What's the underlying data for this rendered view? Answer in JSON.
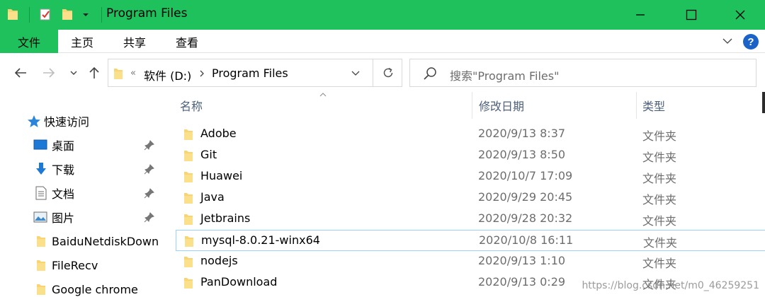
{
  "window": {
    "title": "Program Files",
    "controls": {
      "minimize": "minimize-icon",
      "maximize": "maximize-icon",
      "close": "close-icon"
    }
  },
  "ribbon": {
    "tabs": [
      {
        "label": "文件",
        "active": true
      },
      {
        "label": "主页"
      },
      {
        "label": "共享"
      },
      {
        "label": "查看"
      }
    ],
    "accent_color": "#1ec15b"
  },
  "address": {
    "overflow": "«",
    "segments": [
      "软件 (D:)",
      "Program Files"
    ],
    "search_placeholder": "搜索\"Program Files\""
  },
  "navpane": {
    "quick_access": "快速访问",
    "items": [
      {
        "label": "桌面",
        "icon": "desktop-icon",
        "pinned": true
      },
      {
        "label": "下载",
        "icon": "download-icon",
        "pinned": true
      },
      {
        "label": "文档",
        "icon": "document-icon",
        "pinned": true
      },
      {
        "label": "图片",
        "icon": "pictures-icon",
        "pinned": true
      },
      {
        "label": "BaiduNetdiskDown",
        "icon": "folder-icon",
        "pinned": false
      },
      {
        "label": "FileRecv",
        "icon": "folder-icon",
        "pinned": false
      },
      {
        "label": "Google chrome",
        "icon": "folder-icon",
        "pinned": false
      }
    ]
  },
  "filelist": {
    "columns": {
      "name": "名称",
      "date": "修改日期",
      "type": "类型"
    },
    "rows": [
      {
        "name": "Adobe",
        "date": "2020/9/13 8:37",
        "type": "文件夹"
      },
      {
        "name": "Git",
        "date": "2020/9/13 8:50",
        "type": "文件夹"
      },
      {
        "name": "Huawei",
        "date": "2020/10/7 17:09",
        "type": "文件夹"
      },
      {
        "name": "Java",
        "date": "2020/9/29 20:45",
        "type": "文件夹"
      },
      {
        "name": "Jetbrains",
        "date": "2020/9/28 20:32",
        "type": "文件夹"
      },
      {
        "name": "mysql-8.0.21-winx64",
        "date": "2020/10/8 16:11",
        "type": "文件夹",
        "hovered": true
      },
      {
        "name": "nodejs",
        "date": "2020/9/13 1:10",
        "type": "文件夹"
      },
      {
        "name": "PanDownload",
        "date": "2020/9/13 0:29",
        "type": "文件夹"
      }
    ]
  },
  "watermark": "https://blog.csdn.net/m0_46259251"
}
